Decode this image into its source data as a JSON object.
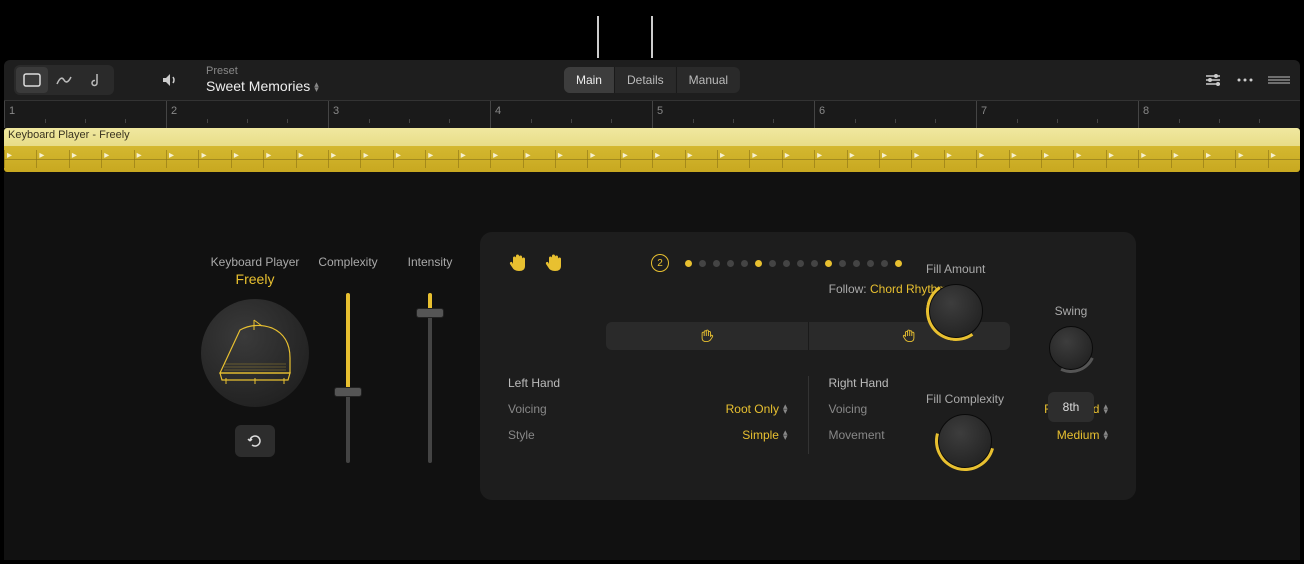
{
  "toolbar": {
    "preset_label": "Preset",
    "preset_name": "Sweet Memories"
  },
  "tabs": {
    "main": "Main",
    "details": "Details",
    "manual": "Manual",
    "active": "Main"
  },
  "ruler": {
    "marks": [
      "1",
      "2",
      "3",
      "4",
      "5",
      "6",
      "7",
      "8"
    ]
  },
  "region": {
    "name": "Keyboard Player - Freely"
  },
  "player": {
    "label": "Keyboard Player",
    "name": "Freely"
  },
  "sliders": {
    "complexity": {
      "label": "Complexity",
      "value": 0.42
    },
    "intensity": {
      "label": "Intensity",
      "value": 0.88
    }
  },
  "pattern": {
    "number": "2",
    "dots": [
      true,
      false,
      false,
      false,
      false,
      true,
      false,
      false,
      false,
      false,
      true,
      false,
      false,
      false,
      false,
      true
    ],
    "follow_label": "Follow:",
    "follow_value": "Chord Rhythm"
  },
  "hands": {
    "left": {
      "title": "Left Hand",
      "voicing_label": "Voicing",
      "voicing_value": "Root Only",
      "style_label": "Style",
      "style_value": "Simple"
    },
    "right": {
      "title": "Right Hand",
      "voicing_label": "Voicing",
      "voicing_value": "Full Chord",
      "movement_label": "Movement",
      "movement_value": "Medium"
    }
  },
  "knobs": {
    "fill_amount": "Fill Amount",
    "fill_complexity": "Fill Complexity",
    "swing": "Swing",
    "note_value": "8th"
  }
}
